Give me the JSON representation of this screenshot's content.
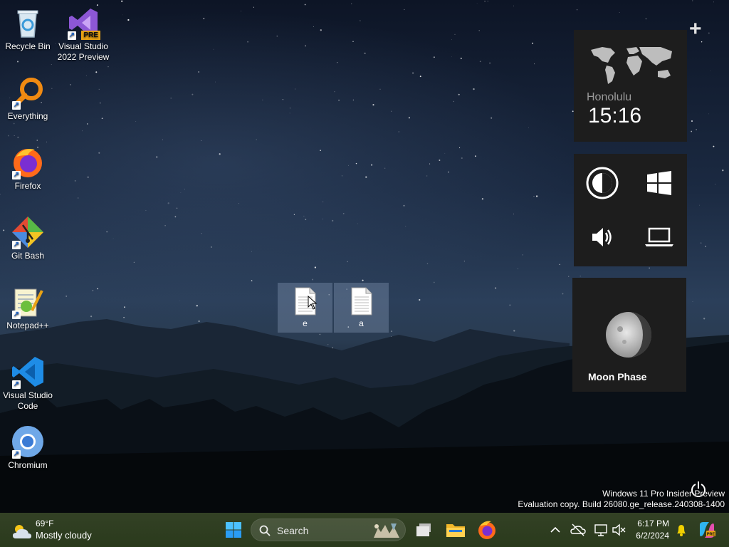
{
  "desktop": {
    "icons": [
      {
        "label": "Recycle Bin"
      },
      {
        "label": "Visual Studio 2022 Preview",
        "badge": "PRE"
      },
      {
        "label": "Everything"
      },
      {
        "label": "Firefox"
      },
      {
        "label": "Git Bash"
      },
      {
        "label": "Notepad++"
      },
      {
        "label": "Visual Studio Code"
      },
      {
        "label": "Chromium"
      }
    ],
    "selected_files": [
      {
        "label": "e"
      },
      {
        "label": "a"
      }
    ]
  },
  "widgets": {
    "add_icon": "plus-icon",
    "clock": {
      "city": "Honolulu",
      "time": "15:16"
    },
    "controls": [
      "contrast-icon",
      "windows-icon",
      "volume-icon",
      "laptop-icon"
    ],
    "moon": {
      "label": "Moon Phase"
    }
  },
  "watermark": {
    "line1": "Windows 11 Pro Insider Preview",
    "line2": "Evaluation copy. Build 26080.ge_release.240308-1400"
  },
  "taskbar": {
    "weather": {
      "temp": "69°F",
      "condition": "Mostly cloudy"
    },
    "search_placeholder": "Search",
    "clock": {
      "time": "6:17 PM",
      "date": "6/2/2024"
    },
    "colors": {
      "accent": "#0078d4",
      "taskbar": "#2c3a1e"
    }
  }
}
